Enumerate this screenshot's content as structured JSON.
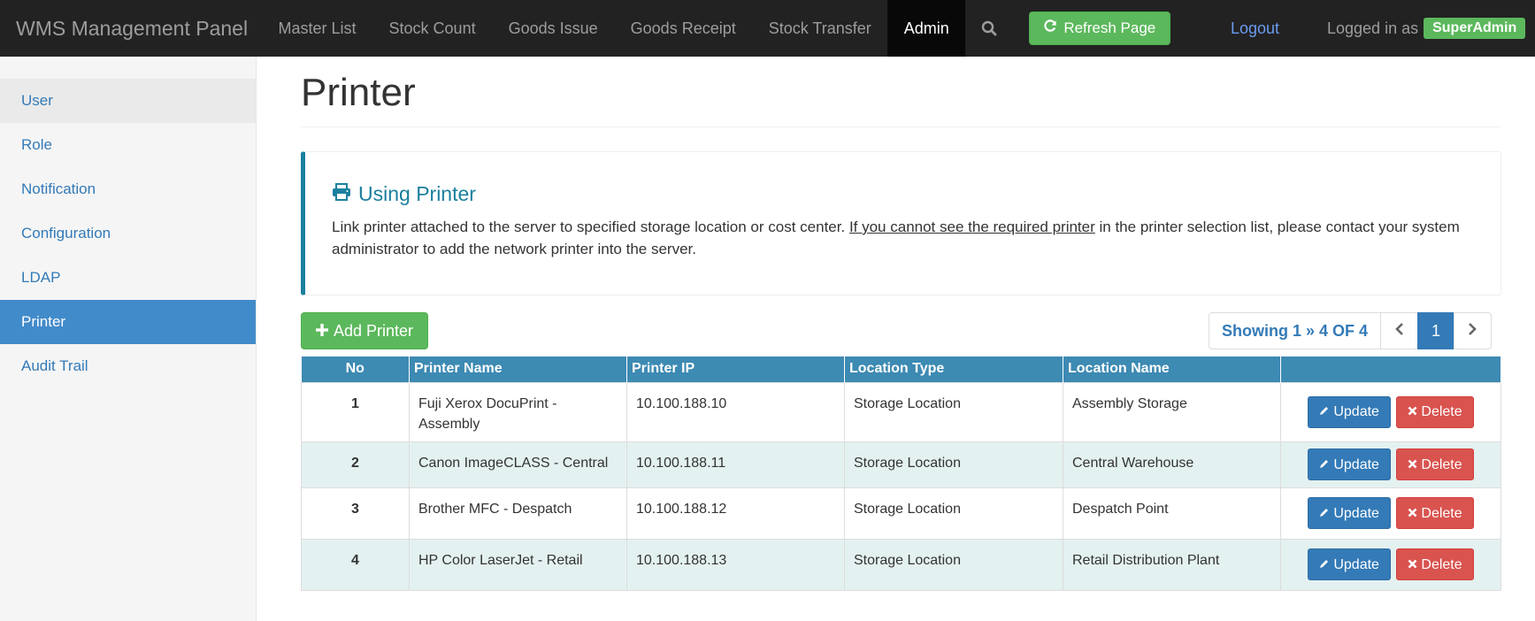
{
  "navbar": {
    "brand": "WMS Management Panel",
    "items": [
      "Master List",
      "Stock Count",
      "Goods Issue",
      "Goods Receipt",
      "Stock Transfer",
      "Admin"
    ],
    "active": "Admin",
    "refresh_label": "Refresh Page",
    "logout_label": "Logout",
    "logged_in_label": "Logged in as",
    "username": "SuperAdmin"
  },
  "sidebar": {
    "items": [
      {
        "label": "User"
      },
      {
        "label": "Role"
      },
      {
        "label": "Notification"
      },
      {
        "label": "Configuration"
      },
      {
        "label": "LDAP"
      },
      {
        "label": "Printer"
      },
      {
        "label": "Audit Trail"
      }
    ],
    "active": "Printer"
  },
  "page": {
    "title": "Printer"
  },
  "callout": {
    "title": "Using Printer",
    "text_before": "Link printer attached to the server to specified storage location or cost center. ",
    "text_underlined": "If you cannot see the required printer",
    "text_after": " in the printer selection list, please contact your system administrator to add the network printer into the server."
  },
  "toolbar": {
    "add_label": "Add Printer",
    "showing_label": "Showing 1 » 4 OF 4",
    "current_page": "1"
  },
  "table": {
    "columns": [
      "No",
      "Printer Name",
      "Printer IP",
      "Location Type",
      "Location Name",
      ""
    ],
    "rows": [
      {
        "no": "1",
        "name": "Fuji Xerox DocuPrint - Assembly",
        "ip": "10.100.188.10",
        "type": "Storage Location",
        "location": "Assembly Storage"
      },
      {
        "no": "2",
        "name": "Canon ImageCLASS - Central",
        "ip": "10.100.188.11",
        "type": "Storage Location",
        "location": "Central Warehouse"
      },
      {
        "no": "3",
        "name": "Brother MFC - Despatch",
        "ip": "10.100.188.12",
        "type": "Storage Location",
        "location": "Despatch Point"
      },
      {
        "no": "4",
        "name": "HP Color LaserJet - Retail",
        "ip": "10.100.188.13",
        "type": "Storage Location",
        "location": "Retail Distribution Plant"
      }
    ],
    "update_label": "Update",
    "delete_label": "Delete"
  },
  "colors": {
    "navbar_bg": "#222222",
    "success": "#5cb85c",
    "primary": "#337ab7",
    "danger": "#d9534f",
    "table_header": "#3d8ab3",
    "row_alt": "#e4f1f1"
  }
}
